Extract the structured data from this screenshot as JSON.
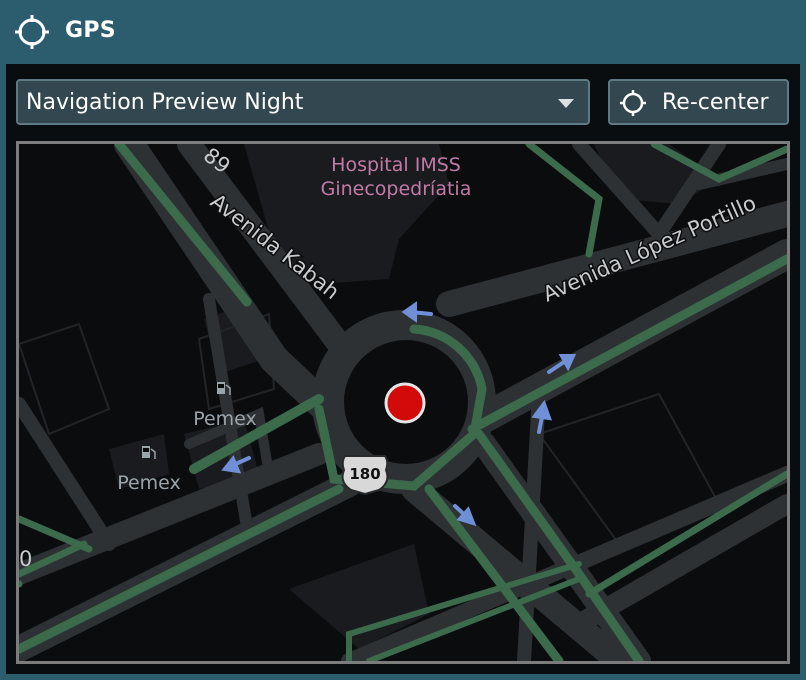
{
  "header": {
    "title": "GPS",
    "icon": "crosshair-icon"
  },
  "toolbar": {
    "map_style_selected": "Navigation Preview Night",
    "recenter_label": "Re-center",
    "recenter_icon": "crosshair-icon"
  },
  "map": {
    "labels": {
      "poi_hospital_line1": "Hospital IMSS",
      "poi_hospital_line2": "Ginecopedríatia",
      "street_kabah": "Avenida Kabah",
      "street_lopez_portillo": "Avenida López Portillo",
      "poi_pemex_1": "Pemex",
      "poi_pemex_2": "Pemex",
      "route_shield": "180",
      "partial_number_top": "89",
      "partial_number_left": "0"
    },
    "colors": {
      "background": "#0b0c0e",
      "road": "#2f3234",
      "traffic": "#3b6b4b",
      "position_marker": "#d20a0a",
      "arrow": "#6f8fd6",
      "hospital_label": "#c27aa8",
      "pemex_label": "#9aa4ab"
    }
  }
}
